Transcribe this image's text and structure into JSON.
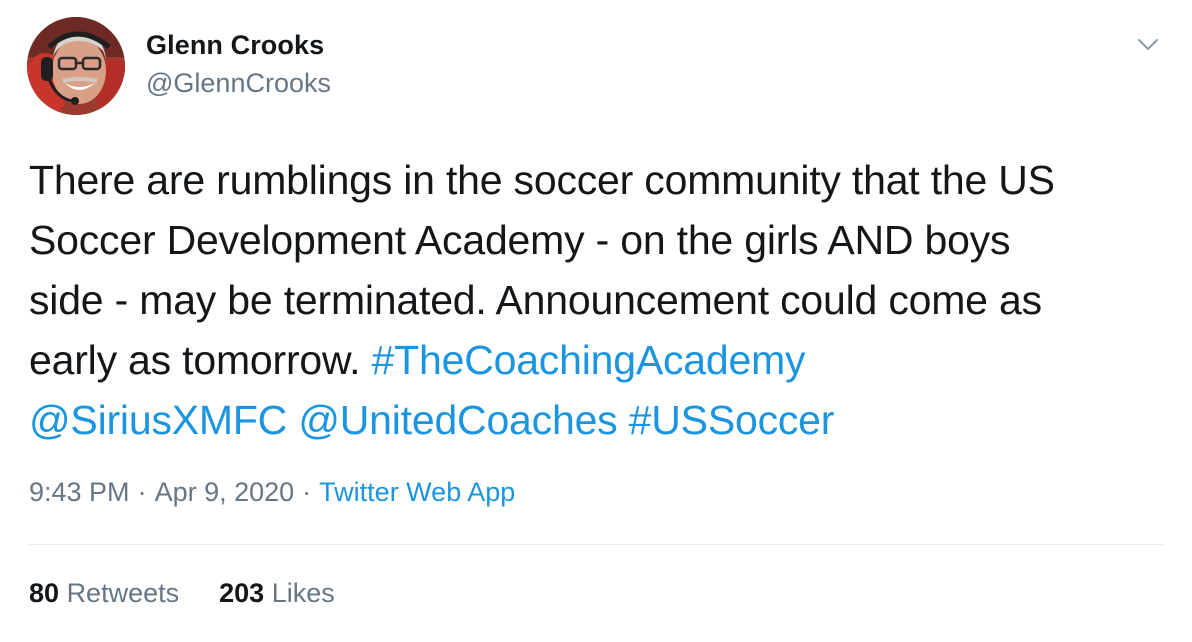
{
  "author": {
    "name": "Glenn Crooks",
    "handle": "@GlennCrooks"
  },
  "tweet": {
    "lines": [
      [
        {
          "text": "There are rumblings in the soccer community that the US",
          "type": "text"
        }
      ],
      [
        {
          "text": "Soccer Development Academy - on the girls AND boys",
          "type": "text"
        }
      ],
      [
        {
          "text": "side - may be terminated. Announcement could come as",
          "type": "text"
        }
      ],
      [
        {
          "text": "early as tomorrow. ",
          "type": "text"
        },
        {
          "text": "#TheCoachingAcademy",
          "type": "hashtag"
        }
      ],
      [
        {
          "text": "@SiriusXMFC",
          "type": "mention"
        },
        {
          "text": " ",
          "type": "text"
        },
        {
          "text": "@UnitedCoaches",
          "type": "mention"
        },
        {
          "text": " ",
          "type": "text"
        },
        {
          "text": "#USSoccer",
          "type": "hashtag"
        }
      ]
    ],
    "time": "9:43 PM",
    "date": "Apr 9, 2020",
    "separator": "·",
    "source": "Twitter Web App"
  },
  "stats": {
    "retweets_count": "80",
    "retweets_label": "Retweets",
    "likes_count": "203",
    "likes_label": "Likes"
  },
  "colors": {
    "link": "#1b95e0",
    "text": "#14171a",
    "secondary": "#657786",
    "divider": "#e6ecf0"
  },
  "icons": {
    "caret": "chevron-down-icon"
  }
}
